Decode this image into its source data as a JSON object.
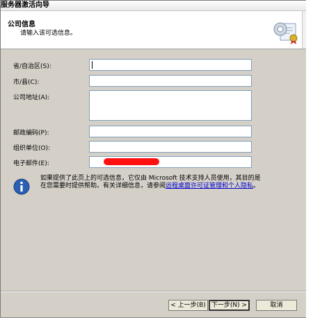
{
  "window": {
    "title": "服务器激活向导"
  },
  "header": {
    "title": "公司信息",
    "subtitle": "请输入该可选信息。"
  },
  "form": {
    "province_label": "省/自治区(S):",
    "city_label": "市/县(C):",
    "address_label": "公司地址(A):",
    "postcode_label": "邮政编码(P):",
    "department_label": "组织单位(O):",
    "email_label": "电子邮件(E):",
    "province_value": "",
    "city_value": "",
    "address_value": "",
    "postcode_value": "",
    "department_value": "",
    "email_value": ""
  },
  "info": {
    "text_part1": "如果提供了此页上的可选信息，它仅由 Microsoft 技术支持人员使用，其目的是在您需要时提供帮助。有关详细信息，请参阅",
    "link_text": "远程桌面许可证管理和个人隐私",
    "text_part2": "。"
  },
  "buttons": {
    "back": "< 上一步(B)",
    "next": "下一步(N) >",
    "cancel": "取消"
  },
  "colors": {
    "dialog_bg": "#d4d0c8",
    "header_bg": "#ffffff",
    "link": "#0000cc",
    "info_icon": "#2b5fb4"
  }
}
